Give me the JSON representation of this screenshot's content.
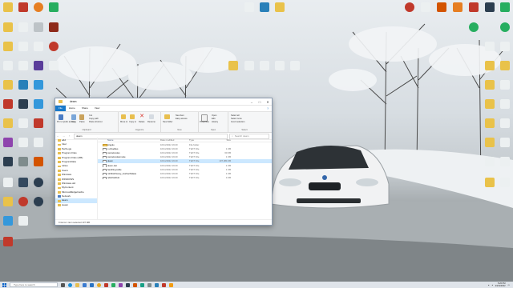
{
  "window": {
    "title": "deam",
    "tabs": [
      "File",
      "Home",
      "Share",
      "View"
    ],
    "active_tab": "File",
    "ribbon": {
      "clipboard": {
        "label": "Clipboard",
        "items": [
          "Pin to Quick access",
          "Copy",
          "Paste",
          "Cut",
          "Copy path",
          "Paste shortcut"
        ]
      },
      "organize": {
        "label": "Organize",
        "items": [
          "Move to",
          "Copy to",
          "Delete",
          "Rename"
        ]
      },
      "new": {
        "label": "New",
        "items": [
          "New folder",
          "New item",
          "Easy access"
        ]
      },
      "open": {
        "label": "Open",
        "items": [
          "Properties",
          "Open",
          "Edit",
          "History"
        ]
      },
      "select": {
        "label": "Select",
        "items": [
          "Select all",
          "Select none",
          "Invert selection"
        ]
      }
    },
    "address": "deam",
    "search_placeholder": "Search deam",
    "columns": [
      "Name",
      "Date modified",
      "Type",
      "Size"
    ],
    "nav_items": [
      {
        "label": "a4d",
        "selected": false
      },
      {
        "label": "Intel",
        "selected": false
      },
      {
        "label": "PerfLogs",
        "selected": false
      },
      {
        "label": "Program Files",
        "selected": false
      },
      {
        "label": "Program Files (x86)",
        "selected": false
      },
      {
        "label": "ProgramData",
        "selected": false
      },
      {
        "label": "rsDev",
        "selected": false
      },
      {
        "label": "Users",
        "selected": false
      },
      {
        "label": "Windows",
        "selected": false
      },
      {
        "label": "WINDOWS",
        "selected": false
      },
      {
        "label": "Windows.old",
        "selected": false
      },
      {
        "label": "MyContent",
        "selected": false
      },
      {
        "label": "MicrosoftEdgeCache",
        "selected": false
      },
      {
        "label": "Network",
        "selected": false,
        "network": true
      },
      {
        "label": "deam",
        "selected": true
      },
      {
        "label": "steam",
        "selected": false
      }
    ],
    "files": [
      {
        "name": "Angulo",
        "date": "10/11/2022 19:20",
        "type": "File folder",
        "size": "",
        "folder": true,
        "selected": false
      },
      {
        "name": "c-drivefiles",
        "date": "10/11/2022 19:20",
        "type": "TEXT File",
        "size": "1 KB",
        "folder": false,
        "selected": false
      },
      {
        "name": "cancelcodes",
        "date": "10/11/2022 19:20",
        "type": "TEXT File",
        "size": "60 KB",
        "folder": false,
        "selected": false
      },
      {
        "name": "cancelcodesmode",
        "date": "10/11/2022 19:20",
        "type": "TEXT File",
        "size": "1 KB",
        "folder": false,
        "selected": false
      },
      {
        "name": "deam",
        "date": "10/11/2022 19:20",
        "type": "TEXT File",
        "size": "107,384 KB",
        "folder": false,
        "selected": true
      },
      {
        "name": "deam.dat",
        "date": "10/11/2022 19:20",
        "type": "TEXT File",
        "size": "1 KB",
        "folder": false,
        "selected": false
      },
      {
        "name": "handling-table",
        "date": "10/11/2022 19:20",
        "type": "TEXT File",
        "size": "1 KB",
        "folder": false,
        "selected": false
      },
      {
        "name": "mbhbsbhsosy_Gorbachklaas",
        "date": "10/11/2022 19:20",
        "type": "TEXT File",
        "size": "1 KB",
        "folder": false,
        "selected": false
      },
      {
        "name": "ndsbhsbhob",
        "date": "10/11/2022 19:20",
        "type": "TEXT File",
        "size": "4 KB",
        "folder": false,
        "selected": false
      }
    ],
    "status": "9 items   1 item selected  107 MB"
  },
  "taskbar": {
    "search_placeholder": "Type here to search",
    "time": "5:26 PM",
    "date": "23/11/2022"
  },
  "colors": {
    "accent": "#1979ca",
    "selection": "#cce8ff",
    "folder": "#e8bf4f"
  }
}
